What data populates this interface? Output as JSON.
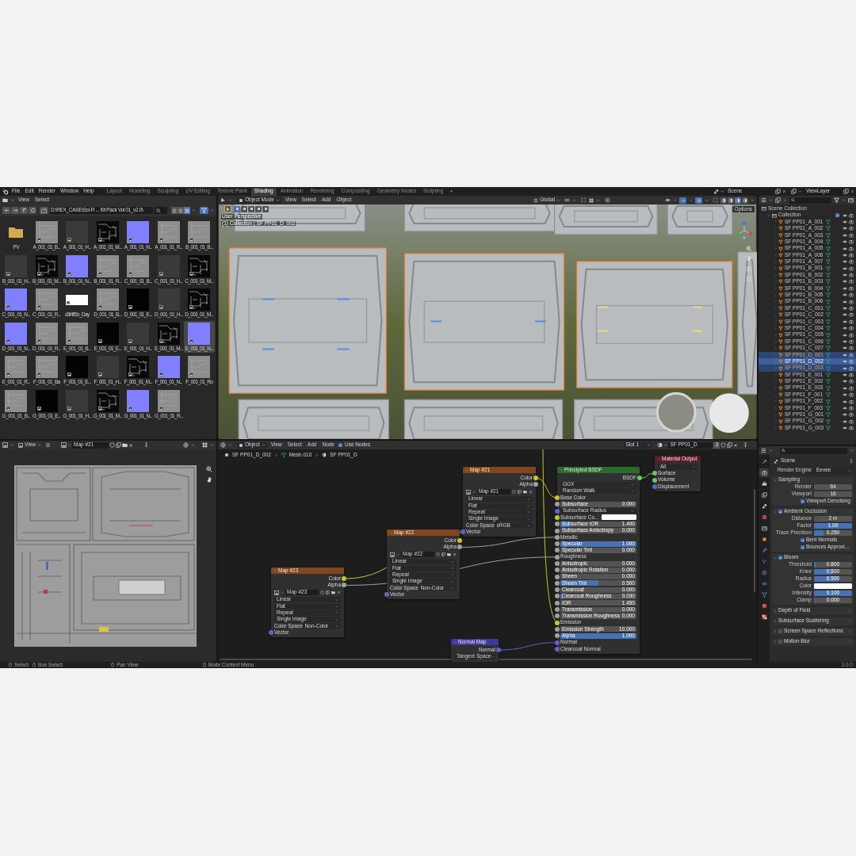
{
  "top_bar": {
    "menus": [
      "File",
      "Edit",
      "Render",
      "Window",
      "Help"
    ],
    "workspaces": [
      {
        "label": "Layout",
        "selected": false
      },
      {
        "label": "Modeling",
        "selected": false
      },
      {
        "label": "Sculpting",
        "selected": false
      },
      {
        "label": "UV Editing",
        "selected": false
      },
      {
        "label": "Texture Paint",
        "selected": false
      },
      {
        "label": "Shading",
        "selected": true
      },
      {
        "label": "Animation",
        "selected": false
      },
      {
        "label": "Rendering",
        "selected": false
      },
      {
        "label": "Compositing",
        "selected": false
      },
      {
        "label": "Geometry Nodes",
        "selected": false
      },
      {
        "label": "Scripting",
        "selected": false
      }
    ],
    "add_tab": "+",
    "scene": "Scene",
    "view_layer": "ViewLayer"
  },
  "file_browser": {
    "menus": [
      "View",
      "Select"
    ],
    "path": "D:\\REX_CASE\\Sci-Fi ... Kit Pack Vol 01_v2.0\\",
    "files": [
      {
        "name": "PV",
        "kind": "folder",
        "selected": false
      },
      {
        "name": "A_001_01_B...",
        "kind": "grayscale",
        "selected": false
      },
      {
        "name": "A_001_01_H...",
        "kind": "empty",
        "selected": false
      },
      {
        "name": "A_001_01_M...",
        "kind": "linework",
        "selected": false
      },
      {
        "name": "A_001_01_N...",
        "kind": "normalmap",
        "selected": false
      },
      {
        "name": "A_001_01_R...",
        "kind": "grayscale",
        "selected": false
      },
      {
        "name": "B_001_01_B...",
        "kind": "grayscale",
        "selected": false
      },
      {
        "name": "B_001_01_H...",
        "kind": "empty",
        "selected": false
      },
      {
        "name": "B_001_01_M...",
        "kind": "linework",
        "selected": false
      },
      {
        "name": "B_001_01_N...",
        "kind": "normalmap",
        "selected": false
      },
      {
        "name": "B_001_01_R...",
        "kind": "grayscale",
        "selected": false
      },
      {
        "name": "C_001_01_B...",
        "kind": "grayscale",
        "selected": false
      },
      {
        "name": "C_001_01_H...",
        "kind": "empty",
        "selected": false
      },
      {
        "name": "C_001_01_M...",
        "kind": "linework",
        "selected": false
      },
      {
        "name": "C_001_01_N...",
        "kind": "normalmap",
        "selected": false
      },
      {
        "name": "C_001_01_R...",
        "kind": "grayscale",
        "selected": false
      },
      {
        "name": "d3f4ff1b_Day",
        "kind": "white",
        "selected": false
      },
      {
        "name": "D_001_01_B...",
        "kind": "grayscale",
        "selected": false
      },
      {
        "name": "D_001_01_E...",
        "kind": "black",
        "selected": false
      },
      {
        "name": "D_001_01_H...",
        "kind": "empty",
        "selected": false
      },
      {
        "name": "D_001_01_M...",
        "kind": "linework",
        "selected": false
      },
      {
        "name": "D_001_01_N...",
        "kind": "normalmap",
        "selected": false
      },
      {
        "name": "D_001_01_R...",
        "kind": "grayscale",
        "selected": false
      },
      {
        "name": "E_001_01_B...",
        "kind": "grayscale",
        "selected": false
      },
      {
        "name": "E_001_01_E...",
        "kind": "black",
        "selected": false
      },
      {
        "name": "E_001_01_H...",
        "kind": "empty",
        "selected": false
      },
      {
        "name": "E_001_01_M...",
        "kind": "linework",
        "selected": false
      },
      {
        "name": "E_001_01_N...",
        "kind": "normalmap",
        "selected": true
      },
      {
        "name": "E_001_01_R...",
        "kind": "grayscale",
        "selected": false
      },
      {
        "name": "F_001_01_Ba",
        "kind": "grayscale",
        "selected": false
      },
      {
        "name": "F_001_01_E...",
        "kind": "black",
        "selected": false
      },
      {
        "name": "F_001_01_H...",
        "kind": "empty",
        "selected": false
      },
      {
        "name": "F_001_01_M...",
        "kind": "linework",
        "selected": false
      },
      {
        "name": "F_001_01_N...",
        "kind": "normalmap",
        "selected": false
      },
      {
        "name": "F_001_01_Ro",
        "kind": "grayscale",
        "selected": false
      },
      {
        "name": "G_001_01_B...",
        "kind": "grayscale",
        "selected": false
      },
      {
        "name": "G_001_01_E...",
        "kind": "black",
        "selected": false
      },
      {
        "name": "G_001_01_H...",
        "kind": "empty",
        "selected": false
      },
      {
        "name": "G_001_01_M...",
        "kind": "linework",
        "selected": false
      },
      {
        "name": "G_001_01_N...",
        "kind": "normalmap",
        "selected": false
      },
      {
        "name": "G_001_01_R...",
        "kind": "grayscale",
        "selected": false
      }
    ]
  },
  "viewport": {
    "mode": "Object Mode",
    "menus": [
      "View",
      "Select",
      "Add",
      "Object"
    ],
    "orientation": "Global",
    "options": "Options",
    "overlay": [
      "User Perspective",
      "(1) Collection | SF PP01_D_002"
    ]
  },
  "outliner": {
    "scene_collection": "Scene Collection",
    "collection": {
      "name": "Collection",
      "expanded": true,
      "checked": true
    },
    "objects": [
      {
        "name": "SF PP01_A_001",
        "selected": false,
        "active": false
      },
      {
        "name": "SF PP01_A_002",
        "selected": false,
        "active": false
      },
      {
        "name": "SF PP01_A_003",
        "selected": false,
        "active": false
      },
      {
        "name": "SF PP01_A_004",
        "selected": false,
        "active": false
      },
      {
        "name": "SF PP01_A_005",
        "selected": false,
        "active": false
      },
      {
        "name": "SF PP01_A_006",
        "selected": false,
        "active": false
      },
      {
        "name": "SF PP01_A_007",
        "selected": false,
        "active": false
      },
      {
        "name": "SF PP01_B_001",
        "selected": false,
        "active": false
      },
      {
        "name": "SF PP01_B_002",
        "selected": false,
        "active": false
      },
      {
        "name": "SF PP01_B_003",
        "selected": false,
        "active": false
      },
      {
        "name": "SF PP01_B_004",
        "selected": false,
        "active": false
      },
      {
        "name": "SF PP01_B_005",
        "selected": false,
        "active": false
      },
      {
        "name": "SF PP01_B_006",
        "selected": false,
        "active": false
      },
      {
        "name": "SF PP01_C_001",
        "selected": false,
        "active": false
      },
      {
        "name": "SF PP01_C_002",
        "selected": false,
        "active": false
      },
      {
        "name": "SF PP01_C_003",
        "selected": false,
        "active": false
      },
      {
        "name": "SF PP01_C_004",
        "selected": false,
        "active": false
      },
      {
        "name": "SF PP01_C_005",
        "selected": false,
        "active": false
      },
      {
        "name": "SF PP01_C_006",
        "selected": false,
        "active": false
      },
      {
        "name": "SF PP01_C_007",
        "selected": false,
        "active": false
      },
      {
        "name": "SF PP01_D_001",
        "selected": true,
        "active": false
      },
      {
        "name": "SF PP01_D_002",
        "selected": true,
        "active": true
      },
      {
        "name": "SF PP01_D_003",
        "selected": true,
        "active": false
      },
      {
        "name": "SF PP01_E_001",
        "selected": false,
        "active": false
      },
      {
        "name": "SF PP01_E_002",
        "selected": false,
        "active": false
      },
      {
        "name": "SF PP01_E_003",
        "selected": false,
        "active": false
      },
      {
        "name": "SF PP01_F_001",
        "selected": false,
        "active": false
      },
      {
        "name": "SF PP01_F_002",
        "selected": false,
        "active": false
      },
      {
        "name": "SF PP01_F_003",
        "selected": false,
        "active": false
      },
      {
        "name": "SF PP01_G_001",
        "selected": false,
        "active": false
      },
      {
        "name": "SF PP01_G_002",
        "selected": false,
        "active": false
      },
      {
        "name": "SF PP01_G_003",
        "selected": false,
        "active": false
      }
    ]
  },
  "image_editor": {
    "menus": [
      "View"
    ],
    "image": "Map #21"
  },
  "node_editor": {
    "mode": "Object",
    "menus": [
      "View",
      "Select",
      "Add",
      "Node"
    ],
    "use_nodes": {
      "label": "Use Nodes",
      "checked": true
    },
    "slot": "Slot 1",
    "material": "SF PP01_D",
    "users": "3",
    "breadcrumbs": [
      "SF PP01_D_002",
      "Mesh.010",
      "SF PP01_D"
    ],
    "nodes": [
      {
        "title": "Map #21",
        "kind": "texture",
        "rows": [
          {
            "kind": "output",
            "label": "Color",
            "socket": {
              "color": "#c7c729"
            }
          },
          {
            "kind": "output",
            "label": "Alpha",
            "socket": {
              "color": "#a1a1a1"
            }
          },
          {
            "kind": "image",
            "value": "Map #21"
          },
          {
            "kind": "dropdown",
            "value": "Linear"
          },
          {
            "kind": "dropdown",
            "value": "Flat"
          },
          {
            "kind": "dropdown",
            "value": "Repeat"
          },
          {
            "kind": "dropdown",
            "value": "Single Image"
          },
          {
            "kind": "labeled",
            "label": "Color Space",
            "value": "sRGB"
          },
          {
            "kind": "input",
            "label": "Vector",
            "socket": {
              "color": "#6363c7"
            }
          }
        ]
      },
      {
        "title": "Principled BSDF",
        "kind": "shader",
        "rows": [
          {
            "kind": "output",
            "label": "BSDF",
            "socket": {
              "color": "#63c763"
            }
          },
          {
            "kind": "dropdown",
            "value": "GGX"
          },
          {
            "kind": "dropdown",
            "value": "Random Walk"
          },
          {
            "kind": "input",
            "label": "Base Color",
            "socket": {
              "color": "#c7c729"
            }
          },
          {
            "kind": "slider",
            "label": "Subsurface",
            "value": "0.000",
            "level": 0,
            "socket": {
              "color": "#a1a1a1"
            }
          },
          {
            "kind": "dropdown",
            "value": "Subsurface Radius",
            "socket": {
              "color": "#6363c7"
            }
          },
          {
            "kind": "color",
            "label": "Subsurface Co...",
            "color": "#ffffff",
            "socket": {
              "color": "#c7c729"
            }
          },
          {
            "kind": "slider",
            "label": "Subsurface IOR",
            "value": "1.400",
            "level": 0.12,
            "socket": {
              "color": "#a1a1a1"
            }
          },
          {
            "kind": "slider",
            "label": "Subsurface Anisotropy",
            "value": "0.000",
            "level": 0,
            "socket": {
              "color": "#a1a1a1"
            }
          },
          {
            "kind": "input",
            "label": "Metallic",
            "socket": {
              "color": "#a1a1a1"
            }
          },
          {
            "kind": "slider",
            "label": "Specular",
            "value": "1.000",
            "level": 1,
            "socket": {
              "color": "#a1a1a1"
            }
          },
          {
            "kind": "slider",
            "label": "Specular Tint",
            "value": "0.000",
            "level": 0,
            "socket": {
              "color": "#a1a1a1"
            }
          },
          {
            "kind": "input",
            "label": "Roughness",
            "socket": {
              "color": "#a1a1a1"
            }
          },
          {
            "kind": "slider",
            "label": "Anisotropic",
            "value": "0.000",
            "level": 0,
            "socket": {
              "color": "#a1a1a1"
            }
          },
          {
            "kind": "slider",
            "label": "Anisotropic Rotation",
            "value": "0.000",
            "level": 0,
            "socket": {
              "color": "#a1a1a1"
            }
          },
          {
            "kind": "slider",
            "label": "Sheen",
            "value": "0.000",
            "level": 0,
            "socket": {
              "color": "#a1a1a1"
            }
          },
          {
            "kind": "slider",
            "label": "Sheen Tint",
            "value": "0.500",
            "level": 0.5,
            "socket": {
              "color": "#a1a1a1"
            }
          },
          {
            "kind": "slider",
            "label": "Clearcoat",
            "value": "0.000",
            "level": 0,
            "socket": {
              "color": "#a1a1a1"
            }
          },
          {
            "kind": "slider",
            "label": "Clearcoat Roughness",
            "value": "0.030",
            "level": 0.03,
            "socket": {
              "color": "#a1a1a1"
            }
          },
          {
            "kind": "slider",
            "label": "IOR",
            "value": "1.450",
            "level": 0,
            "socket": {
              "color": "#a1a1a1"
            }
          },
          {
            "kind": "slider",
            "label": "Transmission",
            "value": "0.000",
            "level": 0,
            "socket": {
              "color": "#a1a1a1"
            }
          },
          {
            "kind": "slider",
            "label": "Transmission Roughness",
            "value": "0.000",
            "level": 0,
            "socket": {
              "color": "#a1a1a1"
            }
          },
          {
            "kind": "input",
            "label": "Emission",
            "socket": {
              "color": "#c7c729"
            }
          },
          {
            "kind": "slider",
            "label": "Emission Strength",
            "value": "10.000",
            "level": 0,
            "socket": {
              "color": "#a1a1a1"
            }
          },
          {
            "kind": "slider",
            "label": "Alpha",
            "value": "1.000",
            "level": 1,
            "socket": {
              "color": "#a1a1a1"
            }
          },
          {
            "kind": "input",
            "label": "Normal",
            "socket": {
              "color": "#6363c7"
            }
          },
          {
            "kind": "input",
            "label": "Clearcoat Normal",
            "socket": {
              "color": "#6363c7"
            }
          }
        ]
      },
      {
        "title": "Material Output",
        "kind": "output",
        "rows": [
          {
            "kind": "dropdown",
            "value": "All"
          },
          {
            "kind": "input",
            "label": "Surface",
            "socket": {
              "color": "#63c763"
            }
          },
          {
            "kind": "input",
            "label": "Volume",
            "socket": {
              "color": "#63c763"
            }
          },
          {
            "kind": "input",
            "label": "Displacement",
            "socket": {
              "color": "#6363c7"
            }
          }
        ]
      },
      {
        "title": "Map #22",
        "kind": "texture",
        "rows": [
          {
            "kind": "output",
            "label": "Color",
            "socket": {
              "color": "#c7c729"
            }
          },
          {
            "kind": "output",
            "label": "Alpha",
            "socket": {
              "color": "#a1a1a1"
            }
          },
          {
            "kind": "image",
            "value": "Map #22"
          },
          {
            "kind": "dropdown",
            "value": "Linear"
          },
          {
            "kind": "dropdown",
            "value": "Flat"
          },
          {
            "kind": "dropdown",
            "value": "Repeat"
          },
          {
            "kind": "dropdown",
            "value": "Single Image"
          },
          {
            "kind": "labeled",
            "label": "Color Space",
            "value": "Non-Color"
          },
          {
            "kind": "input",
            "label": "Vector",
            "socket": {
              "color": "#6363c7"
            }
          }
        ]
      },
      {
        "title": "Map #23",
        "kind": "texture",
        "rows": [
          {
            "kind": "output",
            "label": "Color",
            "socket": {
              "color": "#c7c729"
            }
          },
          {
            "kind": "output",
            "label": "Alpha",
            "socket": {
              "color": "#a1a1a1"
            }
          },
          {
            "kind": "image",
            "value": "Map #23"
          },
          {
            "kind": "dropdown",
            "value": "Linear"
          },
          {
            "kind": "dropdown",
            "value": "Flat"
          },
          {
            "kind": "dropdown",
            "value": "Repeat"
          },
          {
            "kind": "dropdown",
            "value": "Single Image"
          },
          {
            "kind": "labeled",
            "label": "Color Space",
            "value": "Non-Color"
          },
          {
            "kind": "input",
            "label": "Vector",
            "socket": {
              "color": "#6363c7"
            }
          }
        ]
      },
      {
        "title": "Normal Map",
        "kind": "vector",
        "rows": [
          {
            "kind": "output",
            "label": "Normal",
            "socket": {
              "color": "#6363c7"
            }
          },
          {
            "kind": "dropdown",
            "value": "Tangent Space"
          }
        ]
      }
    ]
  },
  "properties": {
    "tabs": [
      {
        "kind": "tool",
        "selected": false
      },
      {
        "kind": "render",
        "selected": true
      },
      {
        "kind": "output",
        "selected": false
      },
      {
        "kind": "view_layer",
        "selected": false
      },
      {
        "kind": "scene",
        "selected": false
      },
      {
        "kind": "world",
        "selected": false
      },
      {
        "kind": "collection",
        "selected": false
      },
      {
        "kind": "object",
        "selected": false
      },
      {
        "kind": "modifier",
        "selected": false
      },
      {
        "kind": "particles",
        "selected": false
      },
      {
        "kind": "physics",
        "selected": false
      },
      {
        "kind": "constraints",
        "selected": false
      },
      {
        "kind": "data",
        "selected": false
      },
      {
        "kind": "material",
        "selected": false
      },
      {
        "kind": "texture",
        "selected": false
      }
    ],
    "context": "Scene",
    "render_engine": {
      "label": "Render Engine",
      "value": "Eevee"
    },
    "panels": [
      {
        "title": "Sampling",
        "expanded": true,
        "rows": [
          {
            "kind": "number",
            "label": "Render",
            "value": "64"
          },
          {
            "kind": "number",
            "label": "Viewport",
            "value": "16"
          },
          {
            "kind": "checkbox",
            "label": "Viewport Denoising",
            "checked": true
          }
        ]
      },
      {
        "title": "Ambient Occlusion",
        "expanded": true,
        "enabled": true,
        "rows": [
          {
            "kind": "number",
            "label": "Distance",
            "value": "2 m"
          },
          {
            "kind": "slider",
            "label": "Factor",
            "value": "1.00",
            "level": 1
          },
          {
            "kind": "slider",
            "label": "Trace Precision",
            "value": "0.250",
            "level": 0.25
          },
          {
            "kind": "checkbox",
            "label": "Bent Normals",
            "checked": true
          },
          {
            "kind": "checkbox",
            "label": "Bounces Approxi...",
            "checked": true
          }
        ]
      },
      {
        "title": "Bloom",
        "expanded": true,
        "enabled": true,
        "rows": [
          {
            "kind": "slider",
            "label": "Threshold",
            "value": "0.800",
            "level": 0.05
          },
          {
            "kind": "slider",
            "label": "Knee",
            "value": "0.500",
            "level": 0.5
          },
          {
            "kind": "slider",
            "label": "Radius",
            "value": "6.500",
            "level": 0.65
          },
          {
            "kind": "color",
            "label": "Color",
            "color": "#ffffff"
          },
          {
            "kind": "slider",
            "label": "Intensity",
            "value": "0.100",
            "level": 1
          },
          {
            "kind": "slider",
            "label": "Clamp",
            "value": "0.000",
            "level": 0
          }
        ]
      },
      {
        "title": "Depth of Field",
        "expanded": false
      },
      {
        "title": "Subsurface Scattering",
        "expanded": false
      },
      {
        "title": "Screen Space Reflections",
        "expanded": false,
        "enabled": false
      },
      {
        "title": "Motion Blur",
        "expanded": false,
        "enabled": false
      }
    ]
  },
  "status_bar": {
    "items": [
      "Select",
      "Box Select",
      "Pan View",
      "Node Context Menu"
    ],
    "version": "3.0.0"
  }
}
